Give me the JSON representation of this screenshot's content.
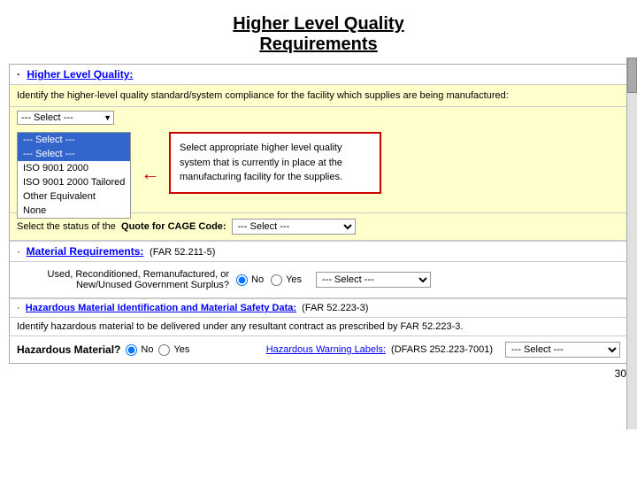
{
  "title": {
    "line1": "Higher Level Quality",
    "line2": "Requirements"
  },
  "section1": {
    "dot": "·",
    "label": "Higher Level Quality:",
    "identify_text": "Identify the higher-level quality standard/system compliance for the facility which supplies are being manufactured:",
    "dropdown_default": "--- Select ---",
    "dropdown_options": [
      "--- Select ---",
      "--- Select ---",
      "ISO 9001 2000",
      "ISO 9001 2000 Tailored",
      "Other Equivalent",
      "None"
    ],
    "tooltip": "Select appropriate higher level quality system that is currently in place at the manufacturing facility for the supplies.",
    "cage_label": "Select the status of the",
    "cage_bold": "Quote for CAGE Code:",
    "cage_default": "--- Select ---"
  },
  "section2": {
    "dot": "·",
    "label": "Material Requirements:",
    "far_ref": "(FAR 52.211-5)",
    "used_label": "Used, Reconditioned, Remanufactured, or New/Unused Government Surplus?",
    "radio_no": "No",
    "radio_yes": "Yes",
    "mat_select_default": "--- Select ---"
  },
  "section3": {
    "dot": "·",
    "label": "Hazardous Material Identification and Material Safety Data:",
    "far_ref": "(FAR 52.223-3)",
    "desc": "Identify hazardous material to be delivered under any resultant contract as prescribed by FAR 52.223-3.",
    "hazmat_label": "Hazardous Material?",
    "radio_no": "No",
    "radio_yes": "Yes",
    "warning_label": "Hazardous Warning Labels:",
    "dfars_ref": "(DFARS 252.223-7001)",
    "warning_select_default": "--- Select ---"
  },
  "page_number": "30"
}
